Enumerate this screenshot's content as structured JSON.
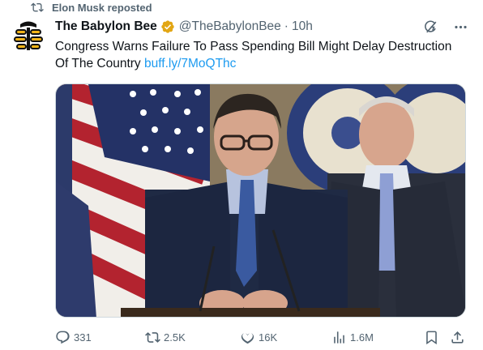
{
  "repost": {
    "label": "Elon Musk reposted",
    "icon": "repost-icon"
  },
  "author": {
    "name": "The Babylon Bee",
    "handle": "@TheBabylonBee",
    "separator": "·",
    "time": "10h",
    "verified_color": "#e2a614",
    "avatar_icon": "babylon-bee-logo"
  },
  "tweet": {
    "text": "Congress Warns Failure To Pass Spending Bill Might Delay Destruction Of The Country",
    "link": "buff.ly/7MoQThc"
  },
  "media": {
    "description_icon": "press-conference-photo"
  },
  "actions": {
    "replies": "331",
    "reposts": "2.5K",
    "likes": "16K",
    "views": "1.6M"
  },
  "colors": {
    "text": "#0f1419",
    "secondary": "#536471",
    "link": "#1d9bf0"
  }
}
